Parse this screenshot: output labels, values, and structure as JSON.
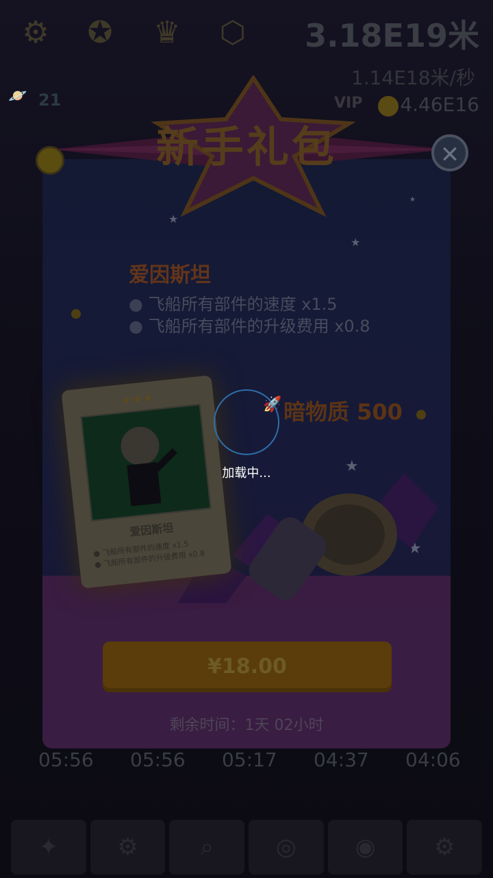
{
  "topbar": {
    "distance": "3.18E19米",
    "speed": "1.14E18米/秒",
    "planet_count": "21",
    "vip_label": "VIP",
    "coins": "4.46E16"
  },
  "popup": {
    "title": "新手礼包",
    "close_symbol": "✕",
    "hero_name": "爱因斯坦",
    "perks": [
      "飞船所有部件的速度 x1.5",
      "飞船所有部件的升级费用 x0.8"
    ],
    "reward": "暗物质 500",
    "card": {
      "stars": "★★★",
      "name": "爱因斯坦",
      "perks": [
        "● 飞船所有部件的速度 x1.5",
        "● 飞船所有部件的升级费用 x0.8"
      ]
    },
    "price": "¥18.00",
    "time_left": "剩余时间：1天 02小时"
  },
  "loading": {
    "text": "加载中..."
  },
  "timers": [
    "05:56",
    "05:56",
    "05:17",
    "04:37",
    "04:06"
  ]
}
